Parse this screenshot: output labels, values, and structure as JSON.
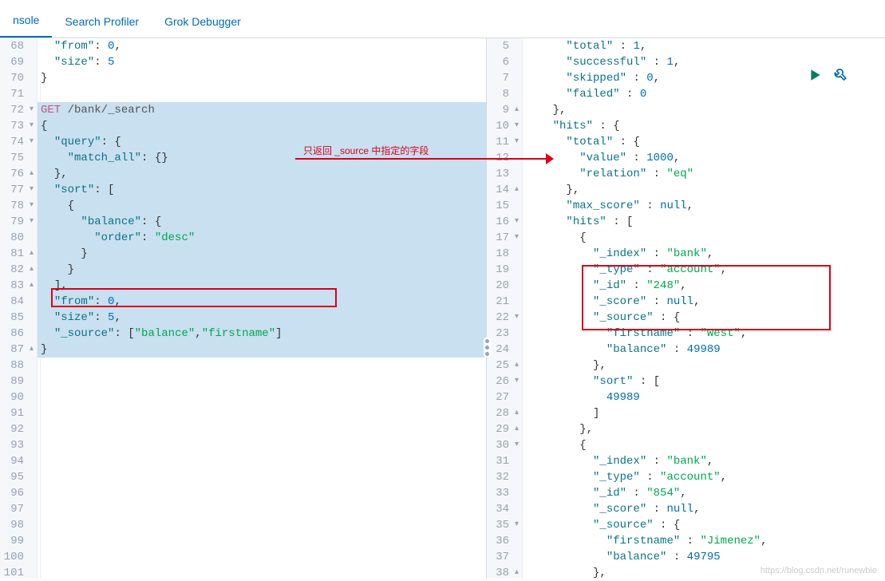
{
  "tabs": {
    "console": "nsole",
    "profiler": "Search Profiler",
    "grok": "Grok Debugger"
  },
  "annotation": "只返回 _source 中指定的字段",
  "watermark": "https://blog.csdn.net/runewbie",
  "left": {
    "start": 68,
    "lines": [
      {
        "t": "cont",
        "indent": 2,
        "tokens": [
          [
            "key",
            "\"from\""
          ],
          [
            "p",
            ": "
          ],
          [
            "num",
            "0"
          ],
          [
            "p",
            ","
          ]
        ]
      },
      {
        "t": "cont",
        "indent": 2,
        "tokens": [
          [
            "key",
            "\"size\""
          ],
          [
            "p",
            ": "
          ],
          [
            "num",
            "5"
          ]
        ]
      },
      {
        "t": "close",
        "indent": 0,
        "tokens": [
          [
            "p",
            "}"
          ]
        ]
      },
      {
        "t": "blank"
      },
      {
        "t": "req",
        "method": "GET",
        "path": "/bank/_search",
        "hl": true,
        "fold": "v"
      },
      {
        "t": "open",
        "indent": 0,
        "tokens": [
          [
            "p",
            "{"
          ]
        ],
        "hl": true,
        "fold": "v"
      },
      {
        "t": "open",
        "indent": 2,
        "tokens": [
          [
            "key",
            "\"query\""
          ],
          [
            "p",
            ": {"
          ]
        ],
        "hl": true,
        "fold": "v"
      },
      {
        "t": "cont",
        "indent": 4,
        "tokens": [
          [
            "key",
            "\"match_all\""
          ],
          [
            "p",
            ": {}"
          ]
        ],
        "hl": true
      },
      {
        "t": "close",
        "indent": 2,
        "tokens": [
          [
            "p",
            "},"
          ]
        ],
        "hl": true,
        "fold": "^"
      },
      {
        "t": "open",
        "indent": 2,
        "tokens": [
          [
            "key",
            "\"sort\""
          ],
          [
            "p",
            ": ["
          ]
        ],
        "hl": true,
        "fold": "v"
      },
      {
        "t": "open",
        "indent": 4,
        "tokens": [
          [
            "p",
            "{"
          ]
        ],
        "hl": true,
        "fold": "v"
      },
      {
        "t": "open",
        "indent": 6,
        "tokens": [
          [
            "key",
            "\"balance\""
          ],
          [
            "p",
            ": {"
          ]
        ],
        "hl": true,
        "fold": "v"
      },
      {
        "t": "cont",
        "indent": 8,
        "tokens": [
          [
            "key",
            "\"order\""
          ],
          [
            "p",
            ": "
          ],
          [
            "str",
            "\"desc\""
          ]
        ],
        "hl": true
      },
      {
        "t": "close",
        "indent": 6,
        "tokens": [
          [
            "p",
            "}"
          ]
        ],
        "hl": true,
        "fold": "^"
      },
      {
        "t": "close",
        "indent": 4,
        "tokens": [
          [
            "p",
            "}"
          ]
        ],
        "hl": true,
        "fold": "^"
      },
      {
        "t": "close",
        "indent": 2,
        "tokens": [
          [
            "p",
            "],"
          ]
        ],
        "hl": true,
        "fold": "^"
      },
      {
        "t": "cont",
        "indent": 2,
        "tokens": [
          [
            "key",
            "\"from\""
          ],
          [
            "p",
            ": "
          ],
          [
            "num",
            "0"
          ],
          [
            "p",
            ","
          ]
        ],
        "hl": true
      },
      {
        "t": "cont",
        "indent": 2,
        "tokens": [
          [
            "key",
            "\"size\""
          ],
          [
            "p",
            ": "
          ],
          [
            "num",
            "5"
          ],
          [
            "p",
            ","
          ]
        ],
        "hl": true
      },
      {
        "t": "cont",
        "indent": 2,
        "tokens": [
          [
            "key",
            "\"_source\""
          ],
          [
            "p",
            ": ["
          ],
          [
            "str",
            "\"balance\""
          ],
          [
            "p",
            ","
          ],
          [
            "str",
            "\"firstname\""
          ],
          [
            "p",
            "]"
          ]
        ],
        "hl": true
      },
      {
        "t": "close",
        "indent": 0,
        "tokens": [
          [
            "p",
            "}"
          ]
        ],
        "hl": true,
        "fold": "^"
      },
      {
        "t": "blank"
      },
      {
        "t": "blank"
      },
      {
        "t": "blank"
      },
      {
        "t": "blank"
      },
      {
        "t": "blank"
      },
      {
        "t": "blank"
      },
      {
        "t": "blank"
      },
      {
        "t": "blank"
      },
      {
        "t": "blank"
      },
      {
        "t": "blank"
      },
      {
        "t": "blank"
      },
      {
        "t": "blank"
      },
      {
        "t": "blank"
      },
      {
        "t": "blank"
      }
    ]
  },
  "right": {
    "start": 5,
    "lines": [
      {
        "indent": 6,
        "tokens": [
          [
            "key",
            "\"total\""
          ],
          [
            "p",
            " : "
          ],
          [
            "num",
            "1"
          ],
          [
            "p",
            ","
          ]
        ]
      },
      {
        "indent": 6,
        "tokens": [
          [
            "key",
            "\"successful\""
          ],
          [
            "p",
            " : "
          ],
          [
            "num",
            "1"
          ],
          [
            "p",
            ","
          ]
        ]
      },
      {
        "indent": 6,
        "tokens": [
          [
            "key",
            "\"skipped\""
          ],
          [
            "p",
            " : "
          ],
          [
            "num",
            "0"
          ],
          [
            "p",
            ","
          ]
        ]
      },
      {
        "indent": 6,
        "tokens": [
          [
            "key",
            "\"failed\""
          ],
          [
            "p",
            " : "
          ],
          [
            "num",
            "0"
          ]
        ]
      },
      {
        "indent": 4,
        "tokens": [
          [
            "p",
            "},"
          ]
        ],
        "fold": "^"
      },
      {
        "indent": 4,
        "tokens": [
          [
            "key",
            "\"hits\""
          ],
          [
            "p",
            " : {"
          ]
        ],
        "fold": "v"
      },
      {
        "indent": 6,
        "tokens": [
          [
            "key",
            "\"total\""
          ],
          [
            "p",
            " : {"
          ]
        ],
        "fold": "v"
      },
      {
        "indent": 8,
        "tokens": [
          [
            "key",
            "\"value\""
          ],
          [
            "p",
            " : "
          ],
          [
            "num",
            "1000"
          ],
          [
            "p",
            ","
          ]
        ]
      },
      {
        "indent": 8,
        "tokens": [
          [
            "key",
            "\"relation\""
          ],
          [
            "p",
            " : "
          ],
          [
            "str",
            "\"eq\""
          ]
        ]
      },
      {
        "indent": 6,
        "tokens": [
          [
            "p",
            "},"
          ]
        ],
        "fold": "^"
      },
      {
        "indent": 6,
        "tokens": [
          [
            "key",
            "\"max_score\""
          ],
          [
            "p",
            " : "
          ],
          [
            "null",
            "null"
          ],
          [
            "p",
            ","
          ]
        ]
      },
      {
        "indent": 6,
        "tokens": [
          [
            "key",
            "\"hits\""
          ],
          [
            "p",
            " : ["
          ]
        ],
        "fold": "v"
      },
      {
        "indent": 8,
        "tokens": [
          [
            "p",
            "{"
          ]
        ],
        "fold": "v"
      },
      {
        "indent": 10,
        "tokens": [
          [
            "key",
            "\"_index\""
          ],
          [
            "p",
            " : "
          ],
          [
            "str",
            "\"bank\""
          ],
          [
            "p",
            ","
          ]
        ]
      },
      {
        "indent": 10,
        "tokens": [
          [
            "key",
            "\"_type\""
          ],
          [
            "p",
            " : "
          ],
          [
            "str",
            "\"account\""
          ],
          [
            "p",
            ","
          ]
        ]
      },
      {
        "indent": 10,
        "tokens": [
          [
            "key",
            "\"_id\""
          ],
          [
            "p",
            " : "
          ],
          [
            "str",
            "\"248\""
          ],
          [
            "p",
            ","
          ]
        ]
      },
      {
        "indent": 10,
        "tokens": [
          [
            "key",
            "\"_score\""
          ],
          [
            "p",
            " : "
          ],
          [
            "null",
            "null"
          ],
          [
            "p",
            ","
          ]
        ]
      },
      {
        "indent": 10,
        "tokens": [
          [
            "key",
            "\"_source\""
          ],
          [
            "p",
            " : {"
          ]
        ],
        "fold": "v"
      },
      {
        "indent": 12,
        "tokens": [
          [
            "key",
            "\"firstname\""
          ],
          [
            "p",
            " : "
          ],
          [
            "str",
            "\"West\""
          ],
          [
            "p",
            ","
          ]
        ]
      },
      {
        "indent": 12,
        "tokens": [
          [
            "key",
            "\"balance\""
          ],
          [
            "p",
            " : "
          ],
          [
            "num",
            "49989"
          ]
        ]
      },
      {
        "indent": 10,
        "tokens": [
          [
            "p",
            "},"
          ]
        ],
        "fold": "^"
      },
      {
        "indent": 10,
        "tokens": [
          [
            "key",
            "\"sort\""
          ],
          [
            "p",
            " : ["
          ]
        ],
        "fold": "v"
      },
      {
        "indent": 12,
        "tokens": [
          [
            "num",
            "49989"
          ]
        ]
      },
      {
        "indent": 10,
        "tokens": [
          [
            "p",
            "]"
          ]
        ],
        "fold": "^"
      },
      {
        "indent": 8,
        "tokens": [
          [
            "p",
            "},"
          ]
        ],
        "fold": "^"
      },
      {
        "indent": 8,
        "tokens": [
          [
            "p",
            "{"
          ]
        ],
        "fold": "v"
      },
      {
        "indent": 10,
        "tokens": [
          [
            "key",
            "\"_index\""
          ],
          [
            "p",
            " : "
          ],
          [
            "str",
            "\"bank\""
          ],
          [
            "p",
            ","
          ]
        ]
      },
      {
        "indent": 10,
        "tokens": [
          [
            "key",
            "\"_type\""
          ],
          [
            "p",
            " : "
          ],
          [
            "str",
            "\"account\""
          ],
          [
            "p",
            ","
          ]
        ]
      },
      {
        "indent": 10,
        "tokens": [
          [
            "key",
            "\"_id\""
          ],
          [
            "p",
            " : "
          ],
          [
            "str",
            "\"854\""
          ],
          [
            "p",
            ","
          ]
        ]
      },
      {
        "indent": 10,
        "tokens": [
          [
            "key",
            "\"_score\""
          ],
          [
            "p",
            " : "
          ],
          [
            "null",
            "null"
          ],
          [
            "p",
            ","
          ]
        ]
      },
      {
        "indent": 10,
        "tokens": [
          [
            "key",
            "\"_source\""
          ],
          [
            "p",
            " : {"
          ]
        ],
        "fold": "v"
      },
      {
        "indent": 12,
        "tokens": [
          [
            "key",
            "\"firstname\""
          ],
          [
            "p",
            " : "
          ],
          [
            "str",
            "\"Jimenez\""
          ],
          [
            "p",
            ","
          ]
        ]
      },
      {
        "indent": 12,
        "tokens": [
          [
            "key",
            "\"balance\""
          ],
          [
            "p",
            " : "
          ],
          [
            "num",
            "49795"
          ]
        ]
      },
      {
        "indent": 10,
        "tokens": [
          [
            "p",
            "},"
          ]
        ],
        "fold": "^"
      }
    ]
  }
}
